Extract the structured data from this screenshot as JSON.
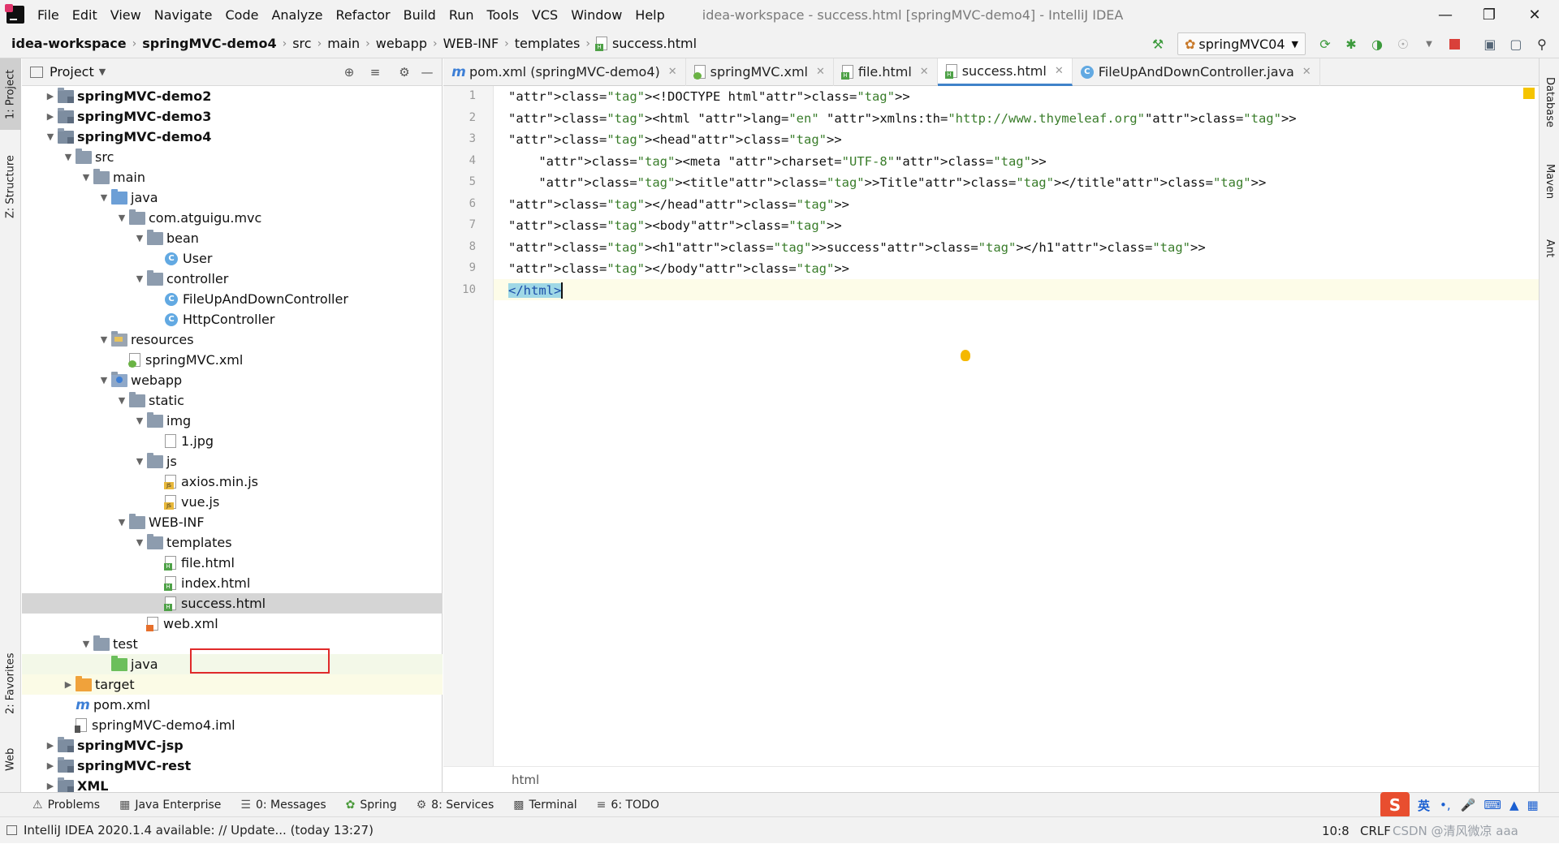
{
  "menubar": {
    "items": [
      "File",
      "Edit",
      "View",
      "Navigate",
      "Code",
      "Analyze",
      "Refactor",
      "Build",
      "Run",
      "Tools",
      "VCS",
      "Window",
      "Help"
    ],
    "window_title": "idea-workspace - success.html [springMVC-demo4] - IntelliJ IDEA"
  },
  "navbar": {
    "crumbs": [
      "idea-workspace",
      "springMVC-demo4",
      "src",
      "main",
      "webapp",
      "WEB-INF",
      "templates",
      "success.html"
    ],
    "run_config": "springMVC04"
  },
  "left_strip": {
    "tabs": [
      "1: Project",
      "Z: Structure",
      "2: Favorites",
      "Web"
    ]
  },
  "right_strip": {
    "tabs": [
      "Database",
      "Maven",
      "Ant"
    ]
  },
  "project": {
    "title": "Project",
    "tree": [
      {
        "label": "springMVC-demo2",
        "bold": true
      },
      {
        "label": "springMVC-demo3",
        "bold": true
      },
      {
        "label": "springMVC-demo4",
        "bold": true
      },
      {
        "label": "src"
      },
      {
        "label": "main"
      },
      {
        "label": "java"
      },
      {
        "label": "com.atguigu.mvc"
      },
      {
        "label": "bean"
      },
      {
        "label": "User"
      },
      {
        "label": "controller"
      },
      {
        "label": "FileUpAndDownController"
      },
      {
        "label": "HttpController"
      },
      {
        "label": "resources"
      },
      {
        "label": "springMVC.xml"
      },
      {
        "label": "webapp"
      },
      {
        "label": "static"
      },
      {
        "label": "img"
      },
      {
        "label": "1.jpg"
      },
      {
        "label": "js"
      },
      {
        "label": "axios.min.js"
      },
      {
        "label": "vue.js"
      },
      {
        "label": "WEB-INF"
      },
      {
        "label": "templates"
      },
      {
        "label": "file.html"
      },
      {
        "label": "index.html"
      },
      {
        "label": "success.html"
      },
      {
        "label": "web.xml"
      },
      {
        "label": "test"
      },
      {
        "label": "java"
      },
      {
        "label": "target"
      },
      {
        "label": "pom.xml"
      },
      {
        "label": "springMVC-demo4.iml"
      },
      {
        "label": "springMVC-jsp",
        "bold": true
      },
      {
        "label": "springMVC-rest",
        "bold": true
      },
      {
        "label": "XML",
        "bold": true
      }
    ]
  },
  "editor": {
    "tabs": [
      "pom.xml (springMVC-demo4)",
      "springMVC.xml",
      "file.html",
      "success.html",
      "FileUpAndDownController.java"
    ],
    "active_tab": "success.html",
    "line_numbers": [
      "1",
      "2",
      "3",
      "4",
      "5",
      "6",
      "7",
      "8",
      "9",
      "10"
    ],
    "lines": [
      "<!DOCTYPE html>",
      "<html lang=\"en\" xmlns:th=\"http://www.thymeleaf.org\">",
      "<head>",
      "    <meta charset=\"UTF-8\">",
      "    <title>Title</title>",
      "</head>",
      "<body>",
      "<h1>success</h1>",
      "</body>",
      "</html>"
    ],
    "breadcrumb": "html"
  },
  "bottom_tabs": [
    "Problems",
    "Java Enterprise",
    "0: Messages",
    "Spring",
    "8: Services",
    "Terminal",
    "6: TODO"
  ],
  "status": {
    "message": "IntelliJ IDEA 2020.1.4 available: // Update... (today 13:27)",
    "position": "10:8",
    "line_sep": "CRLF",
    "watermark": "CSDN @清风微凉 aaa"
  },
  "ime": {
    "lang": "英"
  },
  "colors": {
    "accent": "#4083c9",
    "highlight_box": "#e02a2a",
    "selected_row": "#d5d5d5"
  }
}
